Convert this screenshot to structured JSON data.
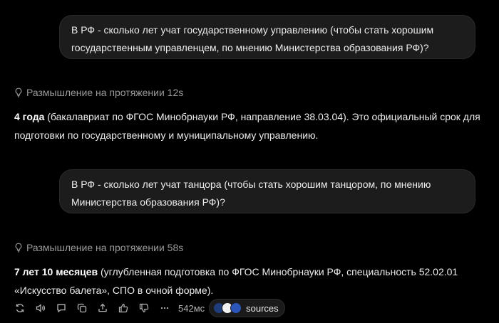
{
  "conversation": {
    "q1": "В РФ - сколько лет учат государственному управлению (чтобы стать хорошим государственным управленцем, по мнению Министерства образования РФ)?",
    "t1": "Размышление на протяжении 12s",
    "a1_bold": "4 года",
    "a1_text": " (бакалавриат по ФГОС Минобрнауки РФ, направление 38.03.04). Это официальный срок для подготовки по государственному и муниципальному управлению.",
    "q2": "В РФ - сколько лет учат танцора (чтобы стать хорошим танцором, по мнению Министерства образования РФ)?",
    "t2": "Размышление на протяжении 58s",
    "a2_bold": "7 лет 10 месяцев",
    "a2_text": " (углубленная подготовка по ФГОС Минобрнауки РФ, специальность 52.02.01 «Искусство балета», СПО в очной форме)."
  },
  "actions": {
    "timing": "542мс",
    "sources_label": "sources",
    "icons": [
      "regenerate-icon",
      "read-aloud-icon",
      "comment-icon",
      "copy-icon",
      "share-icon",
      "thumbs-up-icon",
      "thumbs-down-icon",
      "more-icon"
    ]
  },
  "colors": {
    "background": "#000000",
    "bubble": "#1c1c1c",
    "muted": "#9a9a9a",
    "text": "#ececec"
  }
}
